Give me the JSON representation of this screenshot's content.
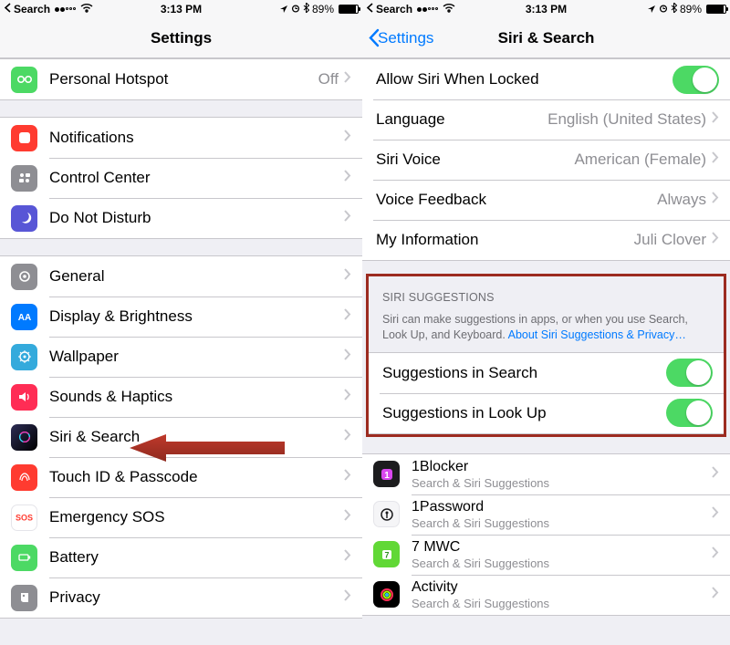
{
  "status": {
    "backApp": "Search",
    "time": "3:13 PM",
    "batteryText": "89%"
  },
  "left": {
    "title": "Settings",
    "row_hotspot": {
      "label": "Personal Hotspot",
      "value": "Off"
    },
    "rows_g2": {
      "notifications": "Notifications",
      "control_center": "Control Center",
      "dnd": "Do Not Disturb"
    },
    "rows_g3": {
      "general": "General",
      "display": "Display & Brightness",
      "wallpaper": "Wallpaper",
      "sounds": "Sounds & Haptics",
      "siri": "Siri & Search",
      "touchid": "Touch ID & Passcode",
      "sos": "Emergency SOS",
      "battery": "Battery",
      "privacy": "Privacy"
    }
  },
  "right": {
    "back": "Settings",
    "title": "Siri & Search",
    "rows_g1": {
      "allow_locked": "Allow Siri When Locked",
      "language": {
        "label": "Language",
        "value": "English (United States)"
      },
      "voice": {
        "label": "Siri Voice",
        "value": "American (Female)"
      },
      "feedback": {
        "label": "Voice Feedback",
        "value": "Always"
      },
      "myinfo": {
        "label": "My Information",
        "value": "Juli Clover"
      }
    },
    "suggestions": {
      "header": "SIRI SUGGESTIONS",
      "footer_text": "Siri can make suggestions in apps, or when you use Search, Look Up, and Keyboard. ",
      "footer_link": "About Siri Suggestions & Privacy…",
      "in_search": "Suggestions in Search",
      "in_lookup": "Suggestions in Look Up"
    },
    "apps": {
      "sub": "Search & Siri Suggestions",
      "a1": "1Blocker",
      "a2": "1Password",
      "a3": "7 MWC",
      "a4": "Activity"
    }
  }
}
